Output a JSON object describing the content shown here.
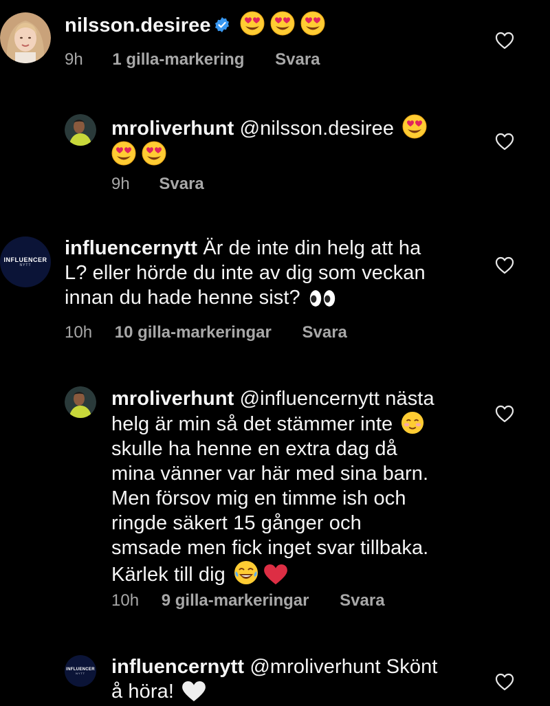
{
  "comments": [
    {
      "username": "nilsson.desiree",
      "verified": true,
      "emojis": "😍😍😍",
      "time": "9h",
      "likes": "1 gilla-markering",
      "reply": "Svara"
    },
    {
      "username": "mroliverhunt",
      "mention": "@nilsson.desiree",
      "time": "9h",
      "reply": "Svara"
    },
    {
      "username": "influencernytt",
      "avatar_text": "INFLUENCER",
      "avatar_subtext": "NYTT",
      "line1": "Är de inte din helg att ha",
      "line2": "L? eller hörde du inte av dig som veckan",
      "line3": "innan du hade henne sist?",
      "time": "10h",
      "likes": "10 gilla-markeringar",
      "reply": "Svara"
    },
    {
      "username": "mroliverhunt",
      "mention": "@influencernytt",
      "line1_rest": "nästa",
      "line2": "helg är min så det stämmer inte",
      "line3": "skulle ha henne en extra dag då",
      "line4": "mina vänner var här med sina barn.",
      "line5": "Men försov mig en timme ish och",
      "line6": "ringde säkert 15 gånger och",
      "line7": "smsade men fick inget svar tillbaka.",
      "line8": "Kärlek till dig",
      "time": "10h",
      "likes": "9 gilla-markeringar",
      "reply": "Svara"
    },
    {
      "username": "influencernytt",
      "avatar_text": "INFLUENCER",
      "avatar_subtext": "NYTT",
      "mention": "@mroliverhunt",
      "line1_rest": "Skönt",
      "line2": "å höra!"
    }
  ],
  "colors": {
    "background": "#000000",
    "text": "#f5f5f5",
    "meta": "#a8a8a8",
    "verified": "#3897f0",
    "avatar_navy": "#0b1437"
  },
  "icons": {
    "like": "heart-outline-icon",
    "verified": "verified-badge-icon"
  }
}
